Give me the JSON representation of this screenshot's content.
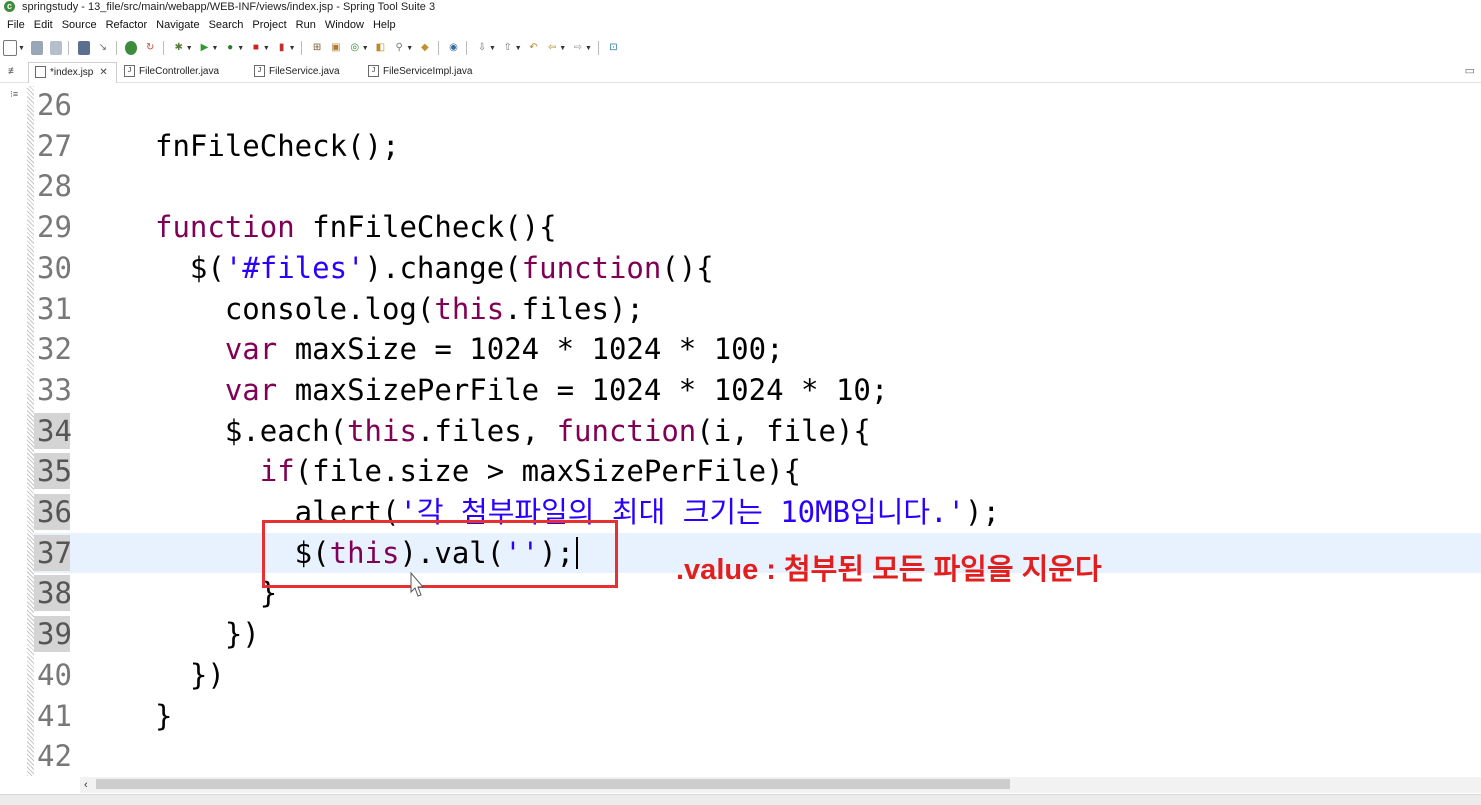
{
  "window": {
    "title": "springstudy - 13_file/src/main/webapp/WEB-INF/views/index.jsp - Spring Tool Suite 3",
    "app_icon": "spring-icon"
  },
  "menu": [
    "File",
    "Edit",
    "Source",
    "Refactor",
    "Navigate",
    "Search",
    "Project",
    "Run",
    "Window",
    "Help"
  ],
  "tabs": [
    {
      "label": "*index.jsp",
      "active": true,
      "closable": true
    },
    {
      "label": "FileController.java",
      "active": false
    },
    {
      "label": "FileService.java",
      "active": false
    },
    {
      "label": "FileServiceImpl.java",
      "active": false
    }
  ],
  "editor": {
    "current_line": 37,
    "lines": [
      {
        "n": "26",
        "tokens": []
      },
      {
        "n": "27",
        "tokens": [
          {
            "t": "fnFileCheck();",
            "c": "plain"
          }
        ]
      },
      {
        "n": "28",
        "tokens": []
      },
      {
        "n": "29",
        "tokens": [
          {
            "t": "function",
            "c": "kw"
          },
          {
            "t": " fnFileCheck(){",
            "c": "plain"
          }
        ]
      },
      {
        "n": "30",
        "tokens": [
          {
            "t": "  $(",
            "c": "plain"
          },
          {
            "t": "'#files'",
            "c": "str"
          },
          {
            "t": ").change(",
            "c": "plain"
          },
          {
            "t": "function",
            "c": "kw"
          },
          {
            "t": "(){",
            "c": "plain"
          }
        ]
      },
      {
        "n": "31",
        "tokens": [
          {
            "t": "    console.log(",
            "c": "plain"
          },
          {
            "t": "this",
            "c": "kw"
          },
          {
            "t": ".files);",
            "c": "plain"
          }
        ]
      },
      {
        "n": "32",
        "tokens": [
          {
            "t": "    ",
            "c": "plain"
          },
          {
            "t": "var",
            "c": "kw"
          },
          {
            "t": " maxSize = 1024 * 1024 * 100;",
            "c": "plain"
          }
        ]
      },
      {
        "n": "33",
        "tokens": [
          {
            "t": "    ",
            "c": "plain"
          },
          {
            "t": "var",
            "c": "kw"
          },
          {
            "t": " maxSizePerFile = 1024 * 1024 * 10;",
            "c": "plain"
          }
        ]
      },
      {
        "n": "34",
        "tokens": [
          {
            "t": "    $.each(",
            "c": "plain"
          },
          {
            "t": "this",
            "c": "kw"
          },
          {
            "t": ".files, ",
            "c": "plain"
          },
          {
            "t": "function",
            "c": "kw"
          },
          {
            "t": "(i, file){",
            "c": "plain"
          }
        ]
      },
      {
        "n": "35",
        "tokens": [
          {
            "t": "      ",
            "c": "plain"
          },
          {
            "t": "if",
            "c": "kw"
          },
          {
            "t": "(file.size > maxSizePerFile){",
            "c": "plain"
          }
        ]
      },
      {
        "n": "36",
        "tokens": [
          {
            "t": "        alert(",
            "c": "plain"
          },
          {
            "t": "'각 첨부파일의 최대 크기는 10MB입니다.'",
            "c": "str"
          },
          {
            "t": ");",
            "c": "plain"
          }
        ]
      },
      {
        "n": "37",
        "tokens": [
          {
            "t": "        $(",
            "c": "plain"
          },
          {
            "t": "this",
            "c": "kw"
          },
          {
            "t": ").val(",
            "c": "plain"
          },
          {
            "t": "''",
            "c": "str"
          },
          {
            "t": ");",
            "c": "plain"
          }
        ]
      },
      {
        "n": "38",
        "tokens": [
          {
            "t": "      }",
            "c": "plain"
          }
        ]
      },
      {
        "n": "39",
        "tokens": [
          {
            "t": "    })",
            "c": "plain"
          }
        ]
      },
      {
        "n": "40",
        "tokens": [
          {
            "t": "  })",
            "c": "plain"
          }
        ]
      },
      {
        "n": "41",
        "tokens": [
          {
            "t": "}",
            "c": "plain"
          }
        ]
      },
      {
        "n": "42",
        "tokens": []
      }
    ],
    "highlighted_line_numbers": [
      "34",
      "35",
      "36",
      "37",
      "38",
      "39"
    ]
  },
  "annotation": {
    "text": ".value : 첨부된 모든 파일을 지운다",
    "color": "#e21f1f"
  },
  "colors": {
    "keyword": "#7f0055",
    "string": "#2a00ff",
    "current_line_bg": "#e8f2fe"
  }
}
